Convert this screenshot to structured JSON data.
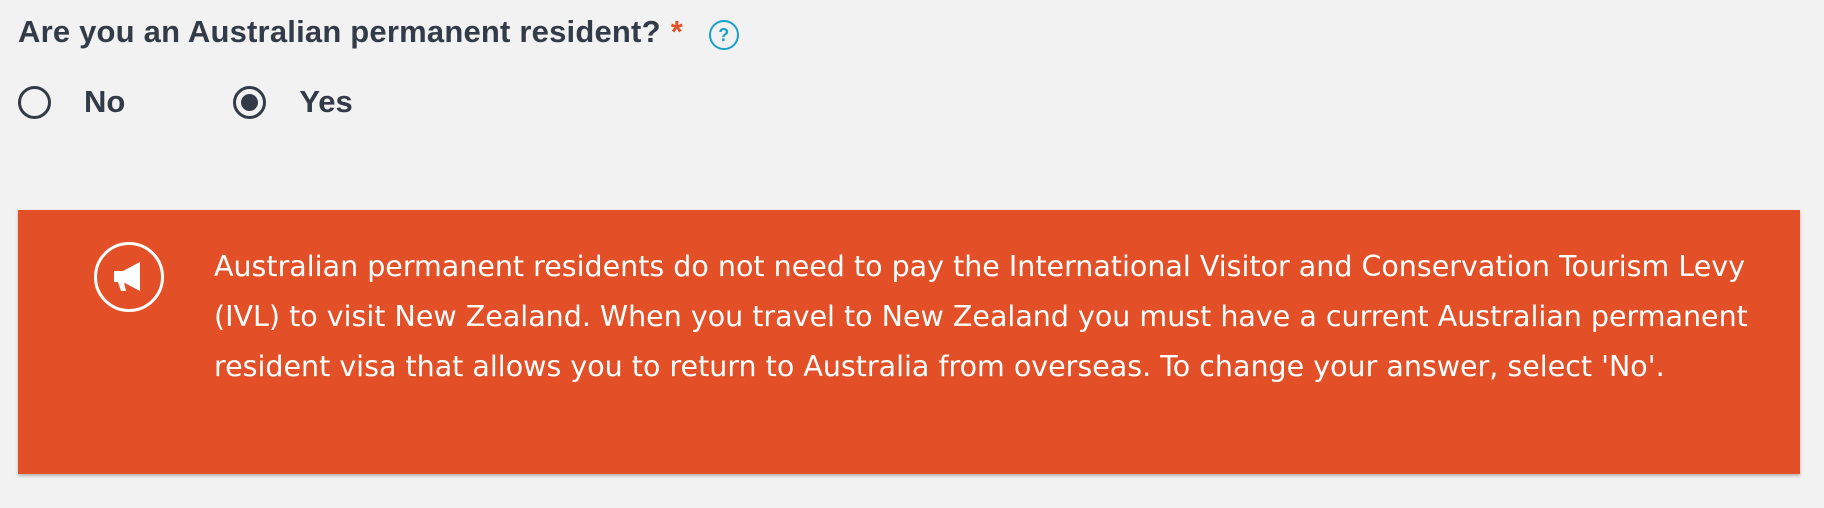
{
  "question": {
    "label": "Are you an Australian permanent resident?",
    "required_mark": "*",
    "help_icon": "question-mark-circle-icon",
    "help_glyph": "?"
  },
  "radio": {
    "options": [
      {
        "label": "No",
        "selected": false
      },
      {
        "label": "Yes",
        "selected": true
      }
    ]
  },
  "banner": {
    "icon": "megaphone-icon",
    "background_color": "#e35027",
    "text": "Australian permanent residents do not need to pay the International Visitor and Conservation Tourism Levy (IVL) to visit New Zealand. When you travel to New Zealand you must have a current Australian permanent resident visa that allows you to return to Australia from overseas. To change your answer, select 'No'."
  },
  "colors": {
    "text": "#333a48",
    "required": "#e4512a",
    "help": "#17a2c9",
    "background": "#f2f2f2"
  }
}
